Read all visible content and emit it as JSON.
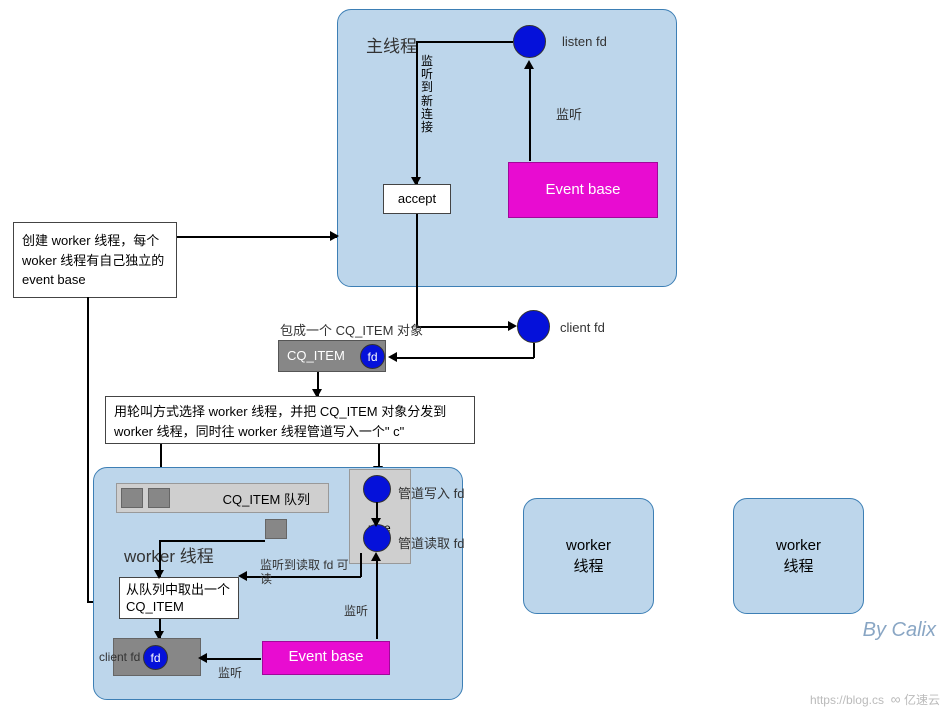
{
  "main_thread": {
    "title": "主线程",
    "listen_fd": "listen fd",
    "listen": "监听",
    "event_base": "Event base",
    "new_conn": "监听到新连接",
    "accept": "accept"
  },
  "note": "创建 worker 线程，每个 woker 线程有自己独立的 event base",
  "cq": {
    "wrap": "包成一个 CQ_ITEM 对象",
    "item": "CQ_ITEM",
    "fd": "fd",
    "client_fd": "client fd"
  },
  "dist": "用轮叫方式选择 worker 线程，并把 CQ_ITEM 对象分发到 worker 线程，同时往 worker 线程管道写入一个\" c\"",
  "worker": {
    "title": "worker 线程",
    "queue": "CQ_ITEM 队列",
    "pipe": "pipe",
    "pipe_w": "管道写入 fd",
    "pipe_r": "管道读取 fd",
    "readable": "监听到读取 fd 可读",
    "listen": "监听",
    "take": "从队列中取出一个 CQ_ITEM",
    "client_fd": "client fd",
    "fd": "fd",
    "event_base": "Event base"
  },
  "workers": {
    "w2": "worker\n线程",
    "w3": "worker\n线程"
  },
  "credit": "By Calix",
  "wm_url": "https://blog.cs",
  "wm_brand": "亿速云"
}
